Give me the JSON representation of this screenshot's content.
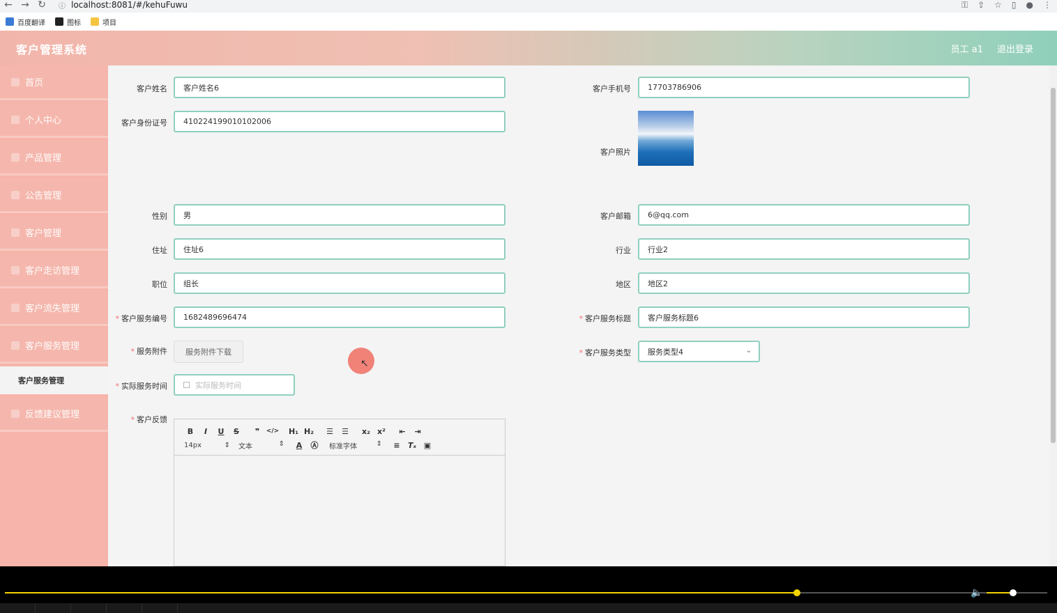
{
  "browser": {
    "url": "localhost:8081/#/kehuFuwu",
    "bookmarks": [
      "百度翻译",
      "图标",
      "项目"
    ]
  },
  "header": {
    "title": "客户管理系统",
    "user": "员工 a1",
    "logout": "退出登录"
  },
  "sidebar": {
    "items": [
      "首页",
      "个人中心",
      "产品管理",
      "公告管理",
      "客户管理",
      "客户走访管理",
      "客户流失管理",
      "客户服务管理"
    ],
    "sub_item": "客户服务管理",
    "last_item": "反馈建议管理"
  },
  "form": {
    "name_label": "客户姓名",
    "name_value": "客户姓名6",
    "phone_label": "客户手机号",
    "phone_value": "17703786906",
    "id_label": "客户身份证号",
    "id_value": "410224199010102006",
    "photo_label": "客户照片",
    "gender_label": "性别",
    "gender_value": "男",
    "email_label": "客户邮箱",
    "email_value": "6@qq.com",
    "address_label": "住址",
    "address_value": "住址6",
    "industry_label": "行业",
    "industry_value": "行业2",
    "position_label": "职位",
    "position_value": "组长",
    "region_label": "地区",
    "region_value": "地区2",
    "service_no_label": "客户服务编号",
    "service_no_value": "1682489696474",
    "service_title_label": "客户服务标题",
    "service_title_value": "客户服务标题6",
    "attachment_label": "服务附件",
    "attachment_button": "服务附件下载",
    "service_type_label": "客户服务类型",
    "service_type_value": "服务类型4",
    "service_time_label": "实际服务时间",
    "service_time_placeholder": "实际服务时间",
    "feedback_label": "客户反馈"
  },
  "editor": {
    "font_size": "14px",
    "text_type": "文本",
    "font_family": "标准字体"
  },
  "player": {
    "progress": 0.76,
    "volume": 0.44
  }
}
